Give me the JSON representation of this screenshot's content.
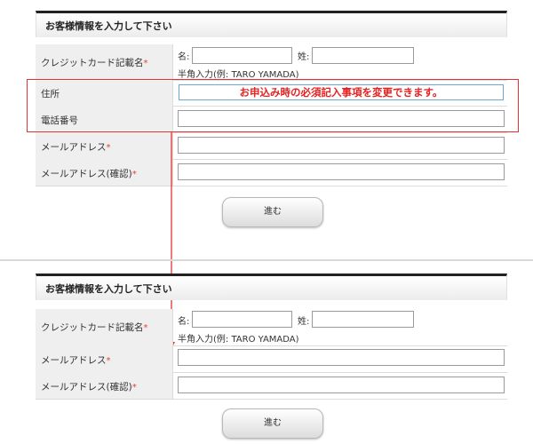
{
  "top_form": {
    "header_title": "お客様情報を入力して下さい",
    "card_name_label": "クレジットカード記載名",
    "first_name_label": "名:",
    "last_name_label": "姓:",
    "hint": "半角入力(例: TARO YAMADA)",
    "address_label": "住所",
    "phone_label": "電話番号",
    "email_label": "メールアドレス",
    "email_confirm_label": "メールアドレス(確認)",
    "required_mark": "*",
    "submit_label": "進む",
    "annotation": "お申込み時の必須記入事項を変更できます。"
  },
  "bottom_form": {
    "header_title": "お客様情報を入力して下さい",
    "card_name_label": "クレジットカード記載名",
    "first_name_label": "名:",
    "last_name_label": "姓:",
    "hint": "半角入力(例: TARO YAMADA)",
    "email_label": "メールアドレス",
    "email_confirm_label": "メールアドレス(確認)",
    "required_mark": "*",
    "submit_label": "進む"
  },
  "colors": {
    "annotation_red": "#e53333",
    "required": "#e0442b",
    "header_border": "#222222"
  }
}
